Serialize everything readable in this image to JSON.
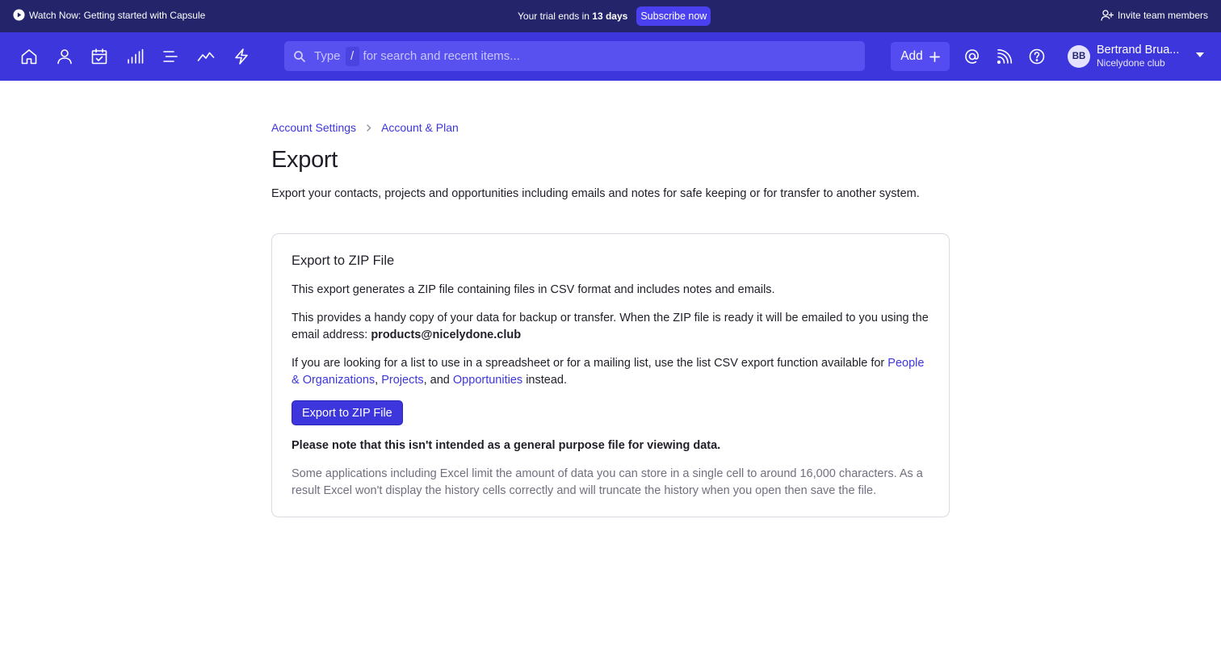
{
  "topbar": {
    "watch_label": "Watch Now: Getting started with Capsule",
    "trial_prefix": "Your trial ends in",
    "trial_days": "13 days",
    "subscribe_label": "Subscribe now",
    "invite_label": "Invite team members"
  },
  "nav": {
    "icons": [
      "home-icon",
      "person-icon",
      "calendar-check-icon",
      "bar-chart-icon",
      "list-icon",
      "trend-line-icon",
      "lightning-icon"
    ],
    "search": {
      "prefix": "Type",
      "shortcut": "/",
      "placeholder": "for search and recent items..."
    },
    "add_label": "Add",
    "right_icons": [
      "at-mention-icon",
      "feed-icon",
      "help-icon"
    ],
    "user": {
      "initials": "BB",
      "name": "Bertrand Brua...",
      "org": "Nicelydone club"
    }
  },
  "breadcrumb": {
    "items": [
      "Account Settings",
      "Account & Plan"
    ]
  },
  "page": {
    "title": "Export",
    "description": "Export your contacts, projects and opportunities including emails and notes for safe keeping or for transfer to another system."
  },
  "card": {
    "title": "Export to ZIP File",
    "p1": "This export generates a ZIP file containing files in CSV format and includes notes and emails.",
    "p2_text": "This provides a handy copy of your data for backup or transfer. When the ZIP file is ready it will be emailed to you using the email address:",
    "p2_email": "products@nicelydone.club",
    "p3_text": "If you are looking for a list to use in a spreadsheet or for a mailing list, use the list CSV export function available for",
    "p3_link1": "People & Organizations",
    "p3_link2": "Projects",
    "p3_and": ", and",
    "p3_link3": "Opportunities",
    "p3_suffix": "instead.",
    "button_label": "Export to ZIP File",
    "note": "Please note that this isn't intended as a general purpose file for viewing data.",
    "muted": "Some applications including Excel limit the amount of data you can store in a single cell to around 16,000 characters. As a result Excel won't display the history cells correctly and will truncate the history when you open then save the file."
  },
  "colors": {
    "topbar_bg": "#23246a",
    "nav_bg": "#3d36dd",
    "accent": "#3d36dd",
    "button_bg": "#3d36dd",
    "muted_text": "#707080"
  }
}
